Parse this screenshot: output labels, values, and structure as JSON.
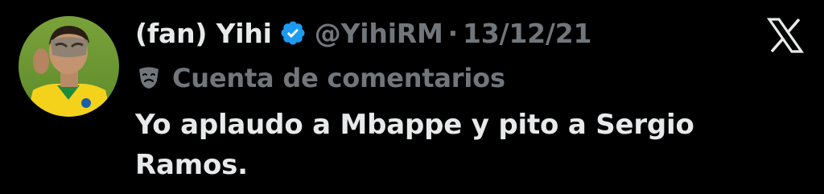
{
  "tweet": {
    "display_name": "(fan) Yihi",
    "handle": "@YihiRM",
    "separator": "·",
    "date": "13/12/21",
    "community_label": "Cuenta de comentarios",
    "text": "Yo aplaudo a Mbappe y pito a Sergio Ramos."
  },
  "icons": {
    "verified": "verified-badge-icon",
    "logo": "x-logo-icon",
    "community": "theater-masks-icon"
  },
  "colors": {
    "background": "#000000",
    "primary_text": "#e7e9ea",
    "secondary_text": "#71767b",
    "verified_blue": "#1d9bf0"
  }
}
